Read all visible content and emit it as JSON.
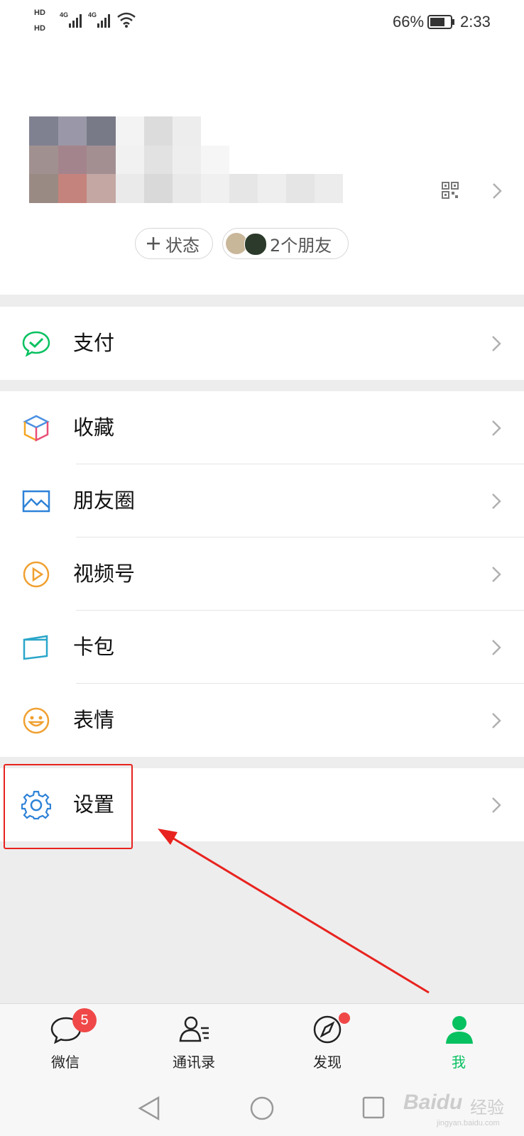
{
  "status_bar": {
    "hd1": "HD",
    "hd2": "HD",
    "net1": "4G",
    "net2": "4G",
    "battery": "66%",
    "time": "2:33"
  },
  "profile": {
    "status_button": "状态",
    "friends_button": "2个朋友"
  },
  "menu": {
    "pay": "支付",
    "favorites": "收藏",
    "moments": "朋友圈",
    "channels": "视频号",
    "cards": "卡包",
    "stickers": "表情",
    "settings": "设置"
  },
  "tabs": {
    "chats": "微信",
    "chats_badge": "5",
    "contacts": "通讯录",
    "discover": "发现",
    "me": "我"
  },
  "colors": {
    "accent": "#07c160",
    "annotation": "#e8231f",
    "badge": "#f04848"
  },
  "watermark": {
    "brand": "Baidu",
    "cn": "经验",
    "url": "jingyan.baidu.com"
  }
}
